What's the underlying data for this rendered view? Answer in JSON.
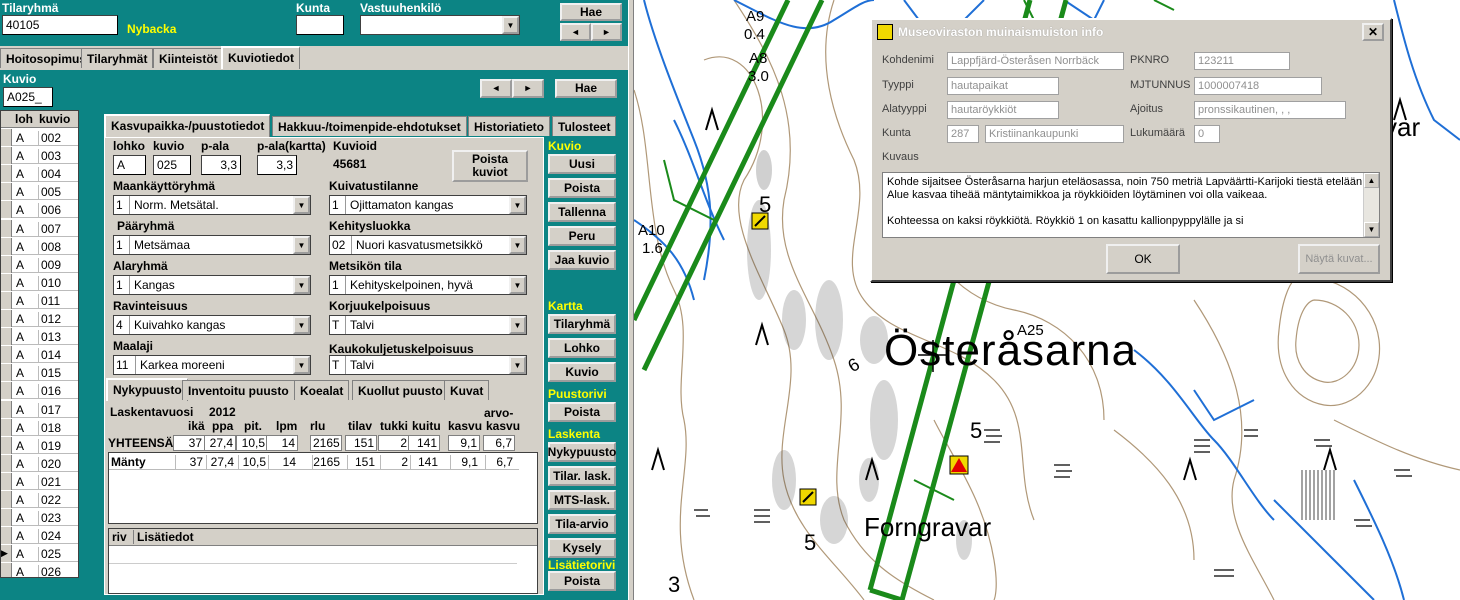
{
  "header": {
    "tilaryhma_label": "Tilaryhmä",
    "tilaryhma_value": "40105",
    "tilaryhma_name": "Nybacka",
    "kunta_label": "Kunta",
    "kunta_value": "",
    "vastuuhenkilo_label": "Vastuuhenkilö",
    "vastuuhenkilo_value": "",
    "hae_label": "Hae",
    "prev": "◄",
    "next": "►"
  },
  "main_tabs": [
    "Hoitosopimus",
    "Tilaryhmät",
    "Kiinteistöt",
    "Kuviotiedot"
  ],
  "kuvio_section": {
    "label": "Kuvio",
    "value": "A025_",
    "hae_label": "Hae",
    "prev": "◄",
    "next": "►"
  },
  "kuvio_list": {
    "columns": [
      "loh",
      "kuvio"
    ],
    "rows": [
      [
        "A",
        "002"
      ],
      [
        "A",
        "003"
      ],
      [
        "A",
        "004"
      ],
      [
        "A",
        "005"
      ],
      [
        "A",
        "006"
      ],
      [
        "A",
        "007"
      ],
      [
        "A",
        "008"
      ],
      [
        "A",
        "009"
      ],
      [
        "A",
        "010"
      ],
      [
        "A",
        "011"
      ],
      [
        "A",
        "012"
      ],
      [
        "A",
        "013"
      ],
      [
        "A",
        "014"
      ],
      [
        "A",
        "015"
      ],
      [
        "A",
        "016"
      ],
      [
        "A",
        "017"
      ],
      [
        "A",
        "018"
      ],
      [
        "A",
        "019"
      ],
      [
        "A",
        "020"
      ],
      [
        "A",
        "021"
      ],
      [
        "A",
        "022"
      ],
      [
        "A",
        "023"
      ],
      [
        "A",
        "024"
      ],
      [
        "A",
        "025"
      ],
      [
        "A",
        "026"
      ]
    ],
    "current_marker": "▶"
  },
  "sub_tabs": [
    "Kasvupaikka-/puustotiedot",
    "Hakkuu-/toimenpide-ehdotukset",
    "Historiatieto",
    "Tulosteet"
  ],
  "form": {
    "lohko_label": "lohko",
    "lohko": "A",
    "kuvio_label": "kuvio",
    "kuvio": "025",
    "pala_label": "p-ala",
    "pala": "3,3",
    "pala_kartta_label": "p-ala(kartta)",
    "pala_kartta": "3,3",
    "kuvioid_label": "Kuvioid",
    "kuvioid": "45681",
    "poista_kuviot": "Poista kuviot",
    "maankaytto_label": "Maankäyttöryhmä",
    "maankaytto_code": "1",
    "maankaytto": "Norm. Metsätal.",
    "kuivatus_label": "Kuivatustilanne",
    "kuivatus_code": "1",
    "kuivatus": "Ojittamaton kangas",
    "paaryhma_label": "Pääryhmä",
    "paaryhma_code": "1",
    "paaryhma": "Metsämaa",
    "kehitys_label": "Kehitysluokka",
    "kehitys_code": "02",
    "kehitys": "Nuori kasvatusmetsikkö",
    "alaryhma_label": "Alaryhmä",
    "alaryhma_code": "1",
    "alaryhma": "Kangas",
    "metsikko_label": "Metsikön tila",
    "metsikko_code": "1",
    "metsikko": "Kehityskelpoinen, hyvä",
    "ravinteisuus_label": "Ravinteisuus",
    "ravinteisuus_code": "4",
    "ravinteisuus": "Kuivahko kangas",
    "korjuu_label": "Korjuukelpoisuus",
    "korjuu_code": "T",
    "korjuu": "Talvi",
    "maalaji_label": "Maalaji",
    "maalaji_code": "11",
    "maalaji": "Karkea moreeni",
    "kaukokuljetus_label": "Kaukokuljetuskelpoisuus",
    "kaukokuljetus_code": "T",
    "kaukokuljetus": "Talvi"
  },
  "puusto_tabs": [
    "Nykypuusto",
    "Inventoitu puusto",
    "Koealat",
    "Kuollut puusto",
    "Kuvat"
  ],
  "puusto": {
    "laskentavuosi_label": "Laskentavuosi",
    "laskentavuosi": "2012",
    "columns": [
      "ikä",
      "ppa",
      "pit.",
      "lpm",
      "rlu",
      "tilav",
      "tukki",
      "kuitu",
      "kasvu",
      "arvo-kasvu"
    ],
    "col_arvo_top": "arvo-",
    "col_kasvu_label": "kasvu",
    "col_arvokasvu_label": "kasvu",
    "total_label": "YHTEENSÄ",
    "total": [
      "37",
      "27,4",
      "10,5",
      "14",
      "2165",
      "151",
      "2",
      "141",
      "9,1",
      "6,7"
    ],
    "rows": [
      {
        "name": "Mänty",
        "values": [
          "37",
          "27,4",
          "10,5",
          "14",
          "2165",
          "151",
          "2",
          "141",
          "9,1",
          "6,7"
        ]
      }
    ]
  },
  "lisatiedot": {
    "col1": "riv",
    "col2": "Lisätiedot"
  },
  "side_buttons": {
    "kuvio_title": "Kuvio",
    "uusi": "Uusi",
    "poista": "Poista",
    "tallenna": "Tallenna",
    "peru": "Peru",
    "jaa_kuvio": "Jaa kuvio",
    "kartta_title": "Kartta",
    "tilaryhma": "Tilaryhmä",
    "lohko": "Lohko",
    "kuvio": "Kuvio",
    "puustorivi_title": "Puustorivi",
    "poista_puusto": "Poista",
    "laskenta_title": "Laskenta",
    "nykypuusto": "Nykypuusto",
    "tilar_lask": "Tilar. lask.",
    "mts_lask": "MTS-lask.",
    "tila_arvio": "Tila-arvio",
    "kysely": "Kysely",
    "lisatietorivi_title": "Lisätietorivi",
    "poista_lisatieto": "Poista"
  },
  "dialog": {
    "title": "Museoviraston muinaismuiston info",
    "close": "✕",
    "kohdenimi_label": "Kohdenimi",
    "kohdenimi": "Lappfjärd-Österåsen Norrbäck",
    "pknro_label": "PKNRO",
    "pknro": "123211",
    "tyyppi_label": "Tyyppi",
    "tyyppi": "hautapaikat",
    "mjtunnus_label": "MJTUNNUS",
    "mjtunnus": "1000007418",
    "alatyyppi_label": "Alatyyppi",
    "alatyyppi": "hautaröykkiöt",
    "ajoitus_label": "Ajoitus",
    "ajoitus": "pronssikautinen, , ,",
    "kunta_label": "Kunta",
    "kunta_code": "287",
    "kunta": "Kristiinankaupunki",
    "lukumaara_label": "Lukumäärä",
    "lukumaara": "0",
    "kuvaus_label": "Kuvaus",
    "kuvaus_1": "Kohde sijaitsee Österåsarna harjun eteläosassa, noin 750 metriä Lapväärtti-Karijoki tiestä etelään.",
    "kuvaus_2": "Alue kasvaa tiheää mäntytaimikkoa ja röykkiöiden löytäminen voi olla vaikeaa.",
    "kuvaus_3": "Kohteessa on kaksi röykkiötä. Röykkiö 1 on kasattu kallionpyppylälle ja si",
    "ok": "OK",
    "nayta_kuvat": "Näytä kuvat..."
  },
  "map": {
    "labels": {
      "a9": "A9",
      "a9_val": "0.4",
      "a8": "A8",
      "a8_val": "3.0",
      "a10": "A10",
      "a10_val": "1.6",
      "a25": "A25",
      "osterasarna": "Österåsarna",
      "forngravar": "Forngravar",
      "var": "var",
      "five_a": "5",
      "five_b": "5",
      "five_c": "5",
      "six": "6",
      "three": "3"
    },
    "colors": {
      "compartment": "#1a8a1a",
      "water": "#1f6fd6",
      "contour": "#b09878"
    }
  }
}
